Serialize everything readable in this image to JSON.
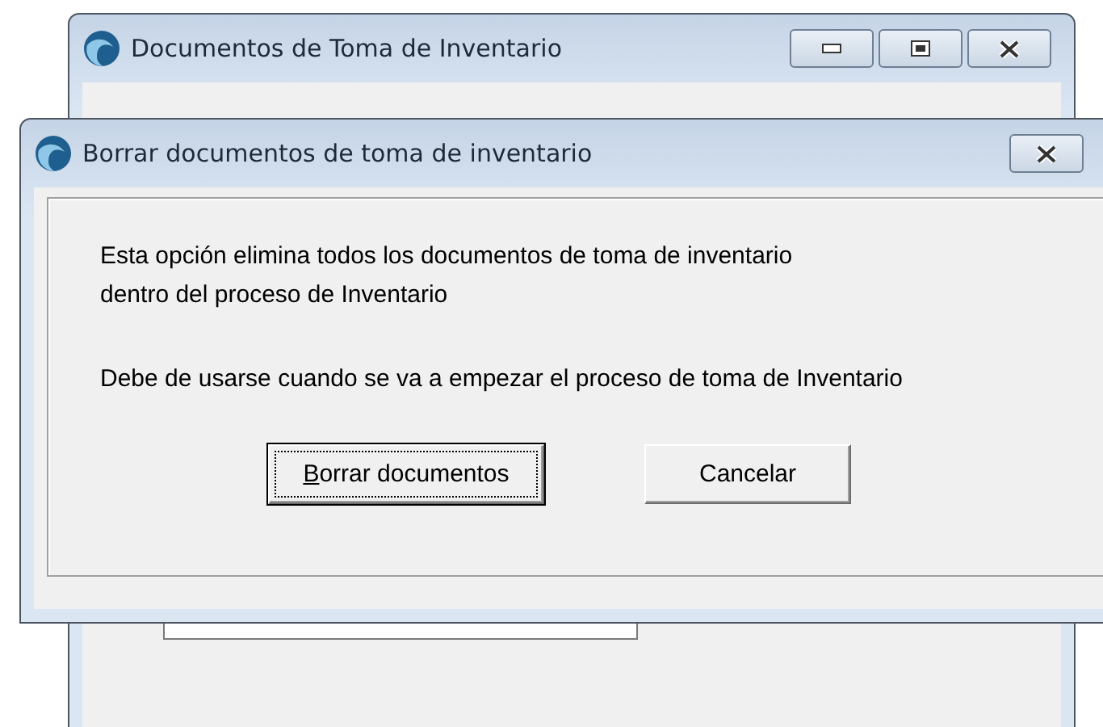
{
  "back_window": {
    "title": "Documentos de Toma de Inventario",
    "has_min_max": true
  },
  "dialog": {
    "title": "Borrar documentos de toma de inventario",
    "paragraphs": [
      "Esta opción elimina todos los documentos de toma de inventario\ndentro del proceso de Inventario",
      "Debe de usarse cuando se va a empezar el proceso de toma de Inventario"
    ],
    "buttons": [
      {
        "label": "Borrar documentos",
        "focused": true,
        "mnemonic": true
      },
      {
        "label": "Cancelar",
        "focused": false,
        "mnemonic": false
      }
    ]
  }
}
